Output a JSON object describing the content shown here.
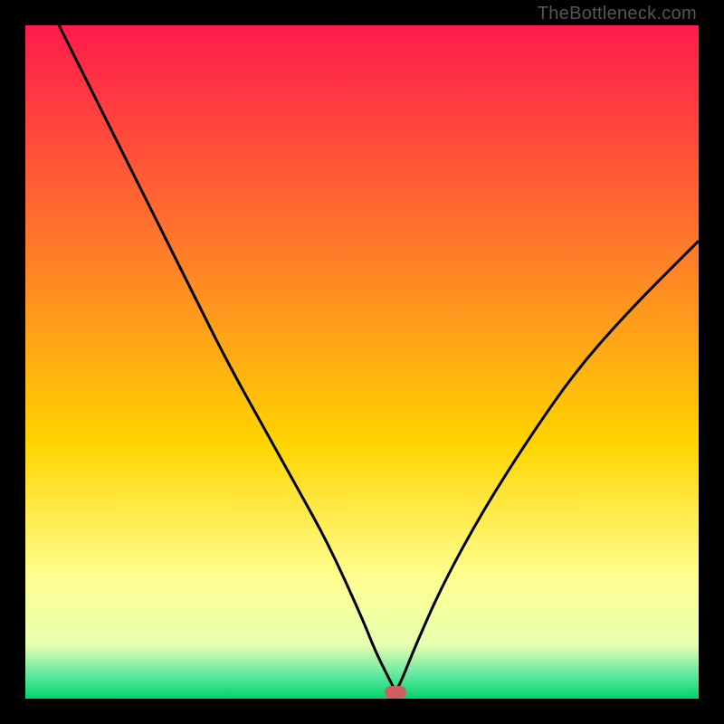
{
  "watermark": "TheBottleneck.com",
  "colors": {
    "top": "#ff1a4d",
    "mid1": "#ff6a2a",
    "mid2": "#ffd400",
    "pale": "#ffffb8",
    "green": "#00e47a",
    "black": "#000000",
    "curve": "#000000",
    "marker": "#cc6060"
  },
  "chart_data": {
    "type": "line",
    "title": "",
    "xlabel": "",
    "ylabel": "",
    "xlim": [
      0,
      100
    ],
    "ylim": [
      0,
      100
    ],
    "series": [
      {
        "name": "bottleneck-curve",
        "x": [
          5,
          10,
          15,
          20,
          25,
          30,
          35,
          40,
          45,
          50,
          52,
          54,
          55,
          56,
          58,
          62,
          68,
          75,
          82,
          90,
          100
        ],
        "values": [
          100,
          90,
          80,
          70,
          60,
          50,
          41,
          32,
          23,
          12,
          7,
          3,
          1,
          3,
          8,
          17,
          28,
          39,
          49,
          58,
          68
        ]
      }
    ],
    "marker": {
      "x": 55,
      "y": 1
    },
    "gradient_stops": [
      {
        "pos": 0.0,
        "color": "#ff1a4d"
      },
      {
        "pos": 0.33,
        "color": "#ff7a2a"
      },
      {
        "pos": 0.62,
        "color": "#ffd400"
      },
      {
        "pos": 0.82,
        "color": "#ffff90"
      },
      {
        "pos": 0.92,
        "color": "#e8ffb0"
      },
      {
        "pos": 0.965,
        "color": "#60e8a0"
      },
      {
        "pos": 1.0,
        "color": "#00d46a"
      }
    ]
  }
}
